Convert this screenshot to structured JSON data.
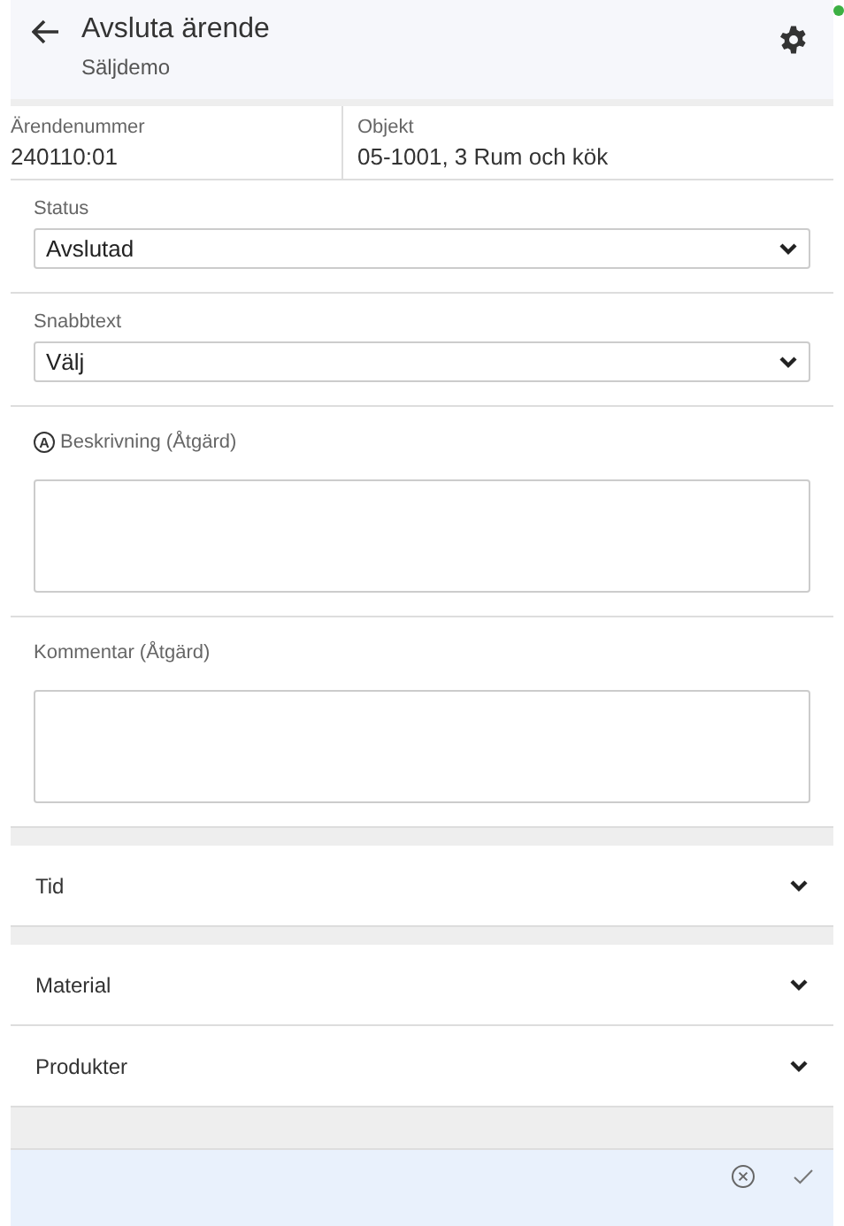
{
  "header": {
    "title": "Avsluta ärende",
    "subtitle": "Säljdemo",
    "online": true
  },
  "info": [
    {
      "label": "Ärendenummer",
      "value": "240110:01"
    },
    {
      "label": "Objekt",
      "value": "05-1001, 3 Rum och kök"
    }
  ],
  "selects": [
    {
      "label": "Status",
      "value": "Avslutad"
    },
    {
      "label": "Snabbtext",
      "value": "Välj"
    }
  ],
  "textareas": [
    {
      "label": "Beskrivning (Åtgärd)",
      "badge": "A"
    },
    {
      "label": "Kommentar (Åtgärd)"
    }
  ],
  "sections": [
    {
      "label": "Tid",
      "expanded": false
    },
    {
      "label": "Material",
      "expanded": false
    },
    {
      "label": "Produkter",
      "expanded": false
    }
  ]
}
